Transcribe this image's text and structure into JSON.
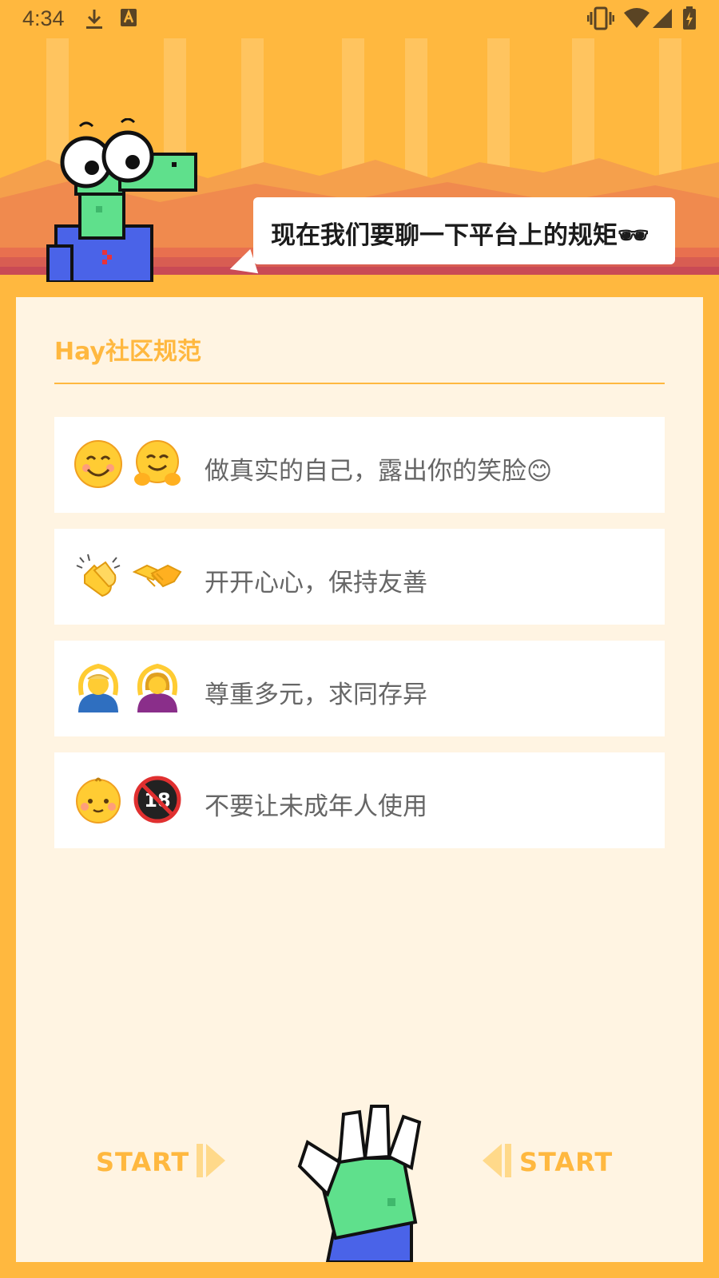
{
  "status_bar": {
    "time": "4:34"
  },
  "header": {
    "speech": "现在我们要聊一下平台上的规矩🕶"
  },
  "panel": {
    "title": "Hay社区规范",
    "rules": [
      {
        "emoji": [
          "smiling-face",
          "hugging-face"
        ],
        "text": "做真实的自己，露出你的笑脸😊"
      },
      {
        "emoji": [
          "clapping-hands",
          "handshake"
        ],
        "text": "开开心心，保持友善"
      },
      {
        "emoji": [
          "man-gesturing-ok",
          "woman-gesturing-ok"
        ],
        "text": "尊重多元，求同存异"
      },
      {
        "emoji": [
          "baby",
          "no-one-under-eighteen"
        ],
        "text": "不要让未成年人使用"
      }
    ],
    "start_left_label": "START",
    "start_right_label": "START"
  },
  "colors": {
    "accent": "#ffb83f",
    "panel_bg": "#fff4e2",
    "card_bg": "#ffffff",
    "text": "#666666",
    "dino_green": "#5fe08c",
    "shirt_blue": "#4a63e8"
  }
}
